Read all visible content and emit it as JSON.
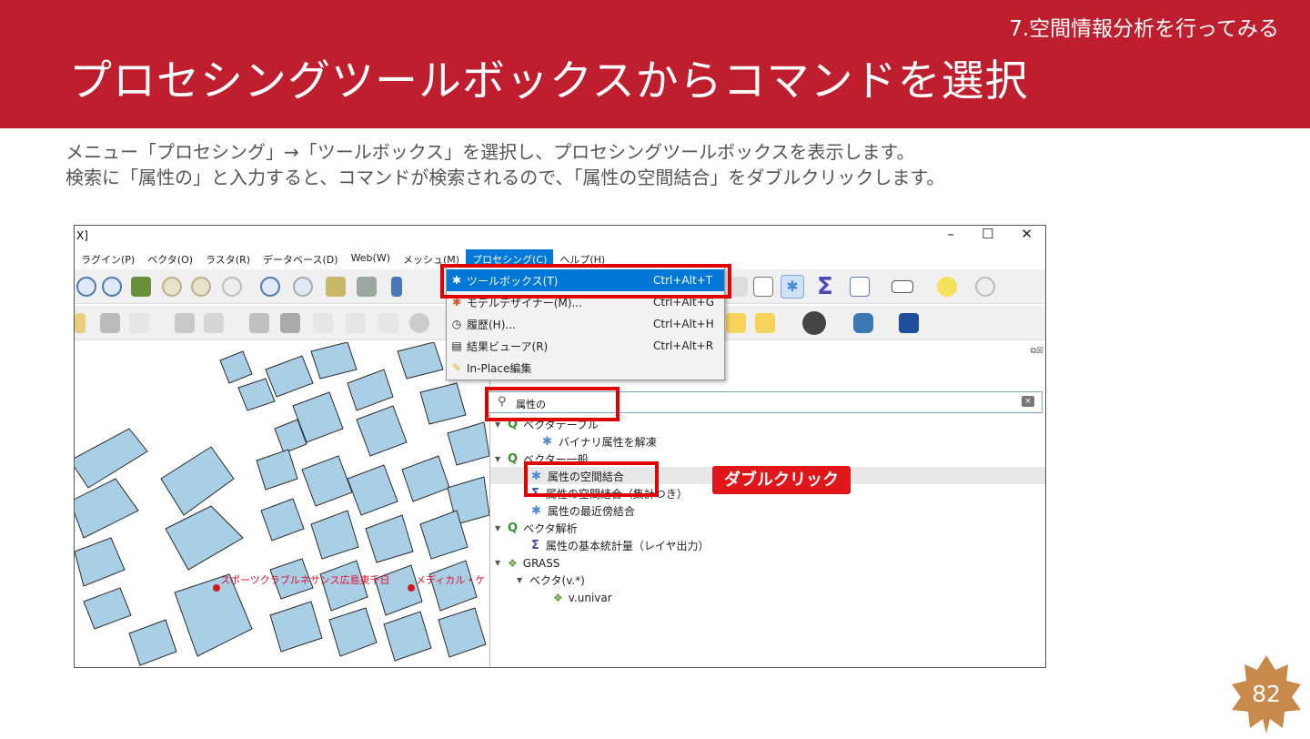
{
  "slide": {
    "section": "7.空間情報分析を行ってみる",
    "title": "プロセシングツールボックスからコマンドを選択",
    "desc_line1": "メニュー「プロセシング」→「ツールボックス」を選択し、プロセシングツールボックスを表示します。",
    "desc_line2": "検索に「属性の」と入力すると、コマンドが検索されるので、「属性の空間結合」をダブルクリックします。",
    "page_number": "82",
    "callout": "ダブルクリック"
  },
  "window": {
    "title_fragment": "X]",
    "minimize": "–",
    "maximize": "☐",
    "close": "✕"
  },
  "menubar": [
    "ラグイン(P)",
    "ベクタ(O)",
    "ラスタ(R)",
    "データベース(D)",
    "Web(W)",
    "メッシュ(M)",
    "プロセシング(C)",
    "ヘルプ(H)"
  ],
  "processing_menu": [
    {
      "label": "ツールボックス(T)",
      "shortcut": "Ctrl+Alt+T",
      "icon": "gear-icon"
    },
    {
      "label": "モデルデザイナー(M)...",
      "shortcut": "Ctrl+Alt+G",
      "icon": "model-icon"
    },
    {
      "label": "履歴(H)...",
      "shortcut": "Ctrl+Alt+H",
      "icon": "clock-icon"
    },
    {
      "label": "結果ビューア(R)",
      "shortcut": "Ctrl+Alt+R",
      "icon": "document-icon"
    },
    {
      "label": "In-Place編集",
      "shortcut": "",
      "icon": "edit-icon"
    }
  ],
  "toolbox": {
    "search_value": "属性の",
    "tree": [
      {
        "label": "ベクタテーブル",
        "level": 0,
        "icon": "qgis-icon"
      },
      {
        "label": "バイナリ属性を解凍",
        "level": 1,
        "icon": "gear-icon"
      },
      {
        "label": "ベクター一般",
        "level": 0,
        "icon": "qgis-icon"
      },
      {
        "label": "属性の空間結合",
        "level": 1,
        "icon": "gear-icon"
      },
      {
        "label": "属性の空間結合（集計つき）",
        "level": 1,
        "icon": "sum-icon"
      },
      {
        "label": "属性の最近傍結合",
        "level": 1,
        "icon": "gear-icon"
      },
      {
        "label": "ベクタ解析",
        "level": 0,
        "icon": "qgis-icon"
      },
      {
        "label": "属性の基本統計量（レイヤ出力）",
        "level": 1,
        "icon": "sum-icon"
      },
      {
        "label": "GRASS",
        "level": 0,
        "icon": "grass-icon"
      },
      {
        "label": "ベクタ(v.*)",
        "level": 1,
        "icon": ""
      },
      {
        "label": "v.univar",
        "level": 2,
        "icon": "grass-icon"
      }
    ]
  },
  "map": {
    "label1": "スポーツクラブルネサンス広島東千日",
    "label2": "メディカル・ケ"
  },
  "colors": {
    "header": "#be1e2d",
    "building": "#a9cfe6",
    "highlight": "#e00000",
    "menu_selected": "#0078d7"
  }
}
